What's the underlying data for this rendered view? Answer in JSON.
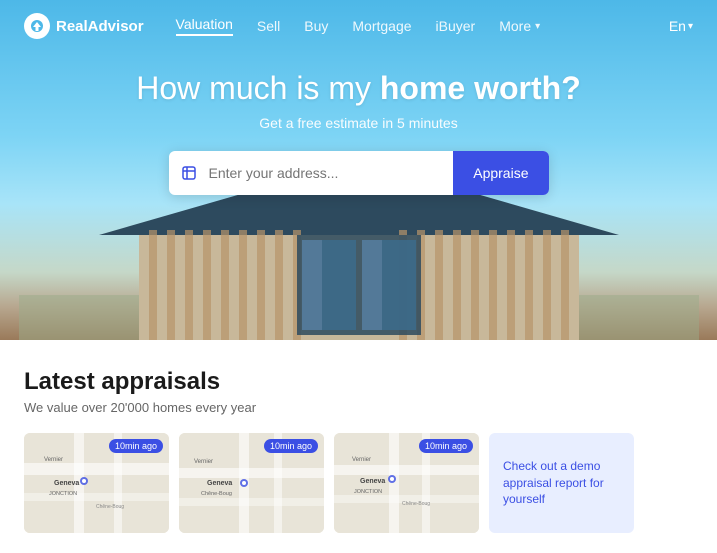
{
  "nav": {
    "logo_text": "RealAdvisor",
    "links": [
      {
        "label": "Valuation",
        "active": true
      },
      {
        "label": "Sell",
        "active": false
      },
      {
        "label": "Buy",
        "active": false
      },
      {
        "label": "Mortgage",
        "active": false
      },
      {
        "label": "iBuyer",
        "active": false
      },
      {
        "label": "More",
        "active": false,
        "has_chevron": true
      }
    ],
    "lang": "En"
  },
  "hero": {
    "title_normal": "How much is my ",
    "title_bold": "home worth?",
    "subtitle": "Get a free estimate in 5 minutes",
    "search_placeholder": "Enter your address...",
    "appraise_label": "Appraise"
  },
  "section": {
    "title": "Latest appraisals",
    "subtitle": "We value over 20'000 homes every year"
  },
  "cards": [
    {
      "badge": "10min ago",
      "location": "Geneva JONCTION"
    },
    {
      "badge": "10min ago",
      "location": "Geneva Chêne-Boug"
    },
    {
      "badge": "10min ago",
      "location": "Geneva JONCTION"
    }
  ],
  "demo_card": {
    "text": "Check out a demo appraisal report for yourself"
  }
}
